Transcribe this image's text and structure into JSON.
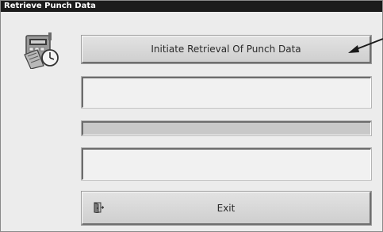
{
  "window": {
    "title": "Retrieve Punch Data"
  },
  "app_icon": {
    "icon": "time-clock-icon"
  },
  "buttons": {
    "initiate_label": "Initiate Retrieval Of Punch Data",
    "exit_label": "Exit",
    "exit_icon": "exit-door-icon"
  },
  "status": {
    "primary_message": "",
    "secondary_message": ""
  },
  "progress": {
    "fraction": 0
  }
}
